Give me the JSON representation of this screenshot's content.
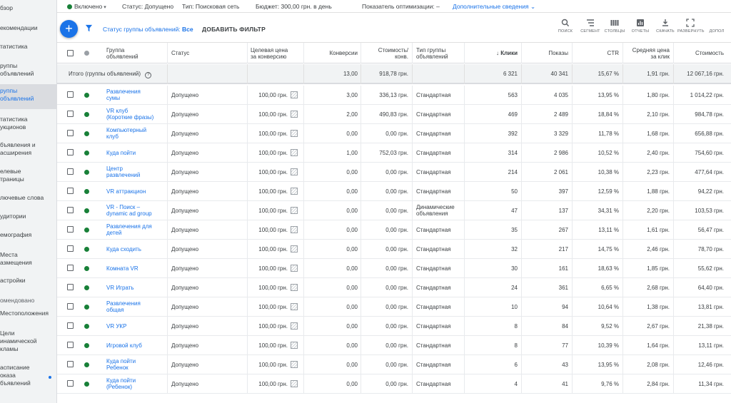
{
  "sidebar": {
    "items": [
      {
        "label": "бзор"
      },
      {
        "label": "екомендации"
      },
      {
        "label": "татистика"
      },
      {
        "label": "руппы\nобъявлений"
      },
      {
        "label": "руппы\nобъявлений",
        "active": true
      },
      {
        "label": "татистика\nукционов"
      },
      {
        "label": "бъявления и\nасширения"
      },
      {
        "label": "елевые\nтраницы"
      },
      {
        "label": "лючевые слова"
      },
      {
        "label": "удитории"
      },
      {
        "label": "емография"
      },
      {
        "label": "Места\nазмещения"
      },
      {
        "label": "астройки"
      },
      {
        "label": "омендовано",
        "section": true
      },
      {
        "label": "Местоположения"
      },
      {
        "label": "Цели\nинамической\nкламы"
      },
      {
        "label": "асписание\nоказа\nбъявлений",
        "dot": true
      }
    ]
  },
  "topbar": {
    "status": "Включено",
    "status_label": "Статус: Допущено",
    "type_label": "Тип: Поисковая сеть",
    "budget_label": "Бюджет: 300,00 грн. в день",
    "optimization_label": "Показатель оптимизации: –",
    "details_link": "Дополнительные сведения"
  },
  "toolbar": {
    "filter_prefix": "Статус группы объявлений: ",
    "filter_value": "Все",
    "add_filter": "ДОБАВИТЬ ФИЛЬТР",
    "tools": [
      {
        "label": "ПОИСК",
        "icon": "search-icon"
      },
      {
        "label": "СЕГМЕНТ",
        "icon": "segment-icon"
      },
      {
        "label": "СТОЛБЦЫ",
        "icon": "columns-icon"
      },
      {
        "label": "ОТЧЕТЫ",
        "icon": "reports-icon"
      },
      {
        "label": "СКАЧАТЬ",
        "icon": "download-icon"
      },
      {
        "label": "РАЗВЕРНУТЬ",
        "icon": "expand-icon"
      },
      {
        "label": "ДОПОЛ",
        "icon": "more-icon"
      }
    ]
  },
  "table": {
    "headers": {
      "group": "Группа\nобъявлений",
      "status": "Статус",
      "target": "Целевая цена\nза конверсию",
      "conversions": "Конверсии",
      "cost_conv": "Стоимость/\nконв.",
      "type": "Тип группы\nобъявлений",
      "clicks": "Клики",
      "impressions": "Показы",
      "ctr": "CTR",
      "avg_cpc": "Средняя цена\nза клик",
      "cost": "Стоимость"
    },
    "totals": {
      "label": "Итого (группы объявлений)",
      "conversions": "13,00",
      "cost_conv": "918,78 грн.",
      "clicks": "6 321",
      "impressions": "40 341",
      "ctr": "15,67 %",
      "avg_cpc": "1,91 грн.",
      "cost": "12 067,16 грн."
    },
    "rows": [
      {
        "name": "Развлечения\nсумы",
        "status": "Допущено",
        "target": "100,00 грн.",
        "conversions": "3,00",
        "cost_conv": "336,13 грн.",
        "type": "Стандартная",
        "clicks": "563",
        "impressions": "4 035",
        "ctr": "13,95 %",
        "avg_cpc": "1,80 грн.",
        "cost": "1 014,22 грн."
      },
      {
        "name": "VR клуб\n(Короткие фразы)",
        "status": "Допущено",
        "target": "100,00 грн.",
        "conversions": "2,00",
        "cost_conv": "490,83 грн.",
        "type": "Стандартная",
        "clicks": "469",
        "impressions": "2 489",
        "ctr": "18,84 %",
        "avg_cpc": "2,10 грн.",
        "cost": "984,78 грн."
      },
      {
        "name": "Компьютерный\nклуб",
        "status": "Допущено",
        "target": "100,00 грн.",
        "conversions": "0,00",
        "cost_conv": "0,00 грн.",
        "type": "Стандартная",
        "clicks": "392",
        "impressions": "3 329",
        "ctr": "11,78 %",
        "avg_cpc": "1,68 грн.",
        "cost": "656,88 грн."
      },
      {
        "name": "Куда пойти",
        "status": "Допущено",
        "target": "100,00 грн.",
        "conversions": "1,00",
        "cost_conv": "752,03 грн.",
        "type": "Стандартная",
        "clicks": "314",
        "impressions": "2 986",
        "ctr": "10,52 %",
        "avg_cpc": "2,40 грн.",
        "cost": "754,60 грн."
      },
      {
        "name": "Центр\nразвлечений",
        "status": "Допущено",
        "target": "100,00 грн.",
        "conversions": "0,00",
        "cost_conv": "0,00 грн.",
        "type": "Стандартная",
        "clicks": "214",
        "impressions": "2 061",
        "ctr": "10,38 %",
        "avg_cpc": "2,23 грн.",
        "cost": "477,64 грн."
      },
      {
        "name": "VR аттракцион",
        "status": "Допущено",
        "target": "100,00 грн.",
        "conversions": "0,00",
        "cost_conv": "0,00 грн.",
        "type": "Стандартная",
        "clicks": "50",
        "impressions": "397",
        "ctr": "12,59 %",
        "avg_cpc": "1,88 грн.",
        "cost": "94,22 грн."
      },
      {
        "name": "VR - Поиск –\ndynamic ad group",
        "status": "Допущено",
        "target": "100,00 грн.",
        "conversions": "0,00",
        "cost_conv": "0,00 грн.",
        "type": "Динамические\nобъявления",
        "clicks": "47",
        "impressions": "137",
        "ctr": "34,31 %",
        "avg_cpc": "2,20 грн.",
        "cost": "103,53 грн."
      },
      {
        "name": "Развлечения для\nдетей",
        "status": "Допущено",
        "target": "100,00 грн.",
        "conversions": "0,00",
        "cost_conv": "0,00 грн.",
        "type": "Стандартная",
        "clicks": "35",
        "impressions": "267",
        "ctr": "13,11 %",
        "avg_cpc": "1,61 грн.",
        "cost": "56,47 грн."
      },
      {
        "name": "Куда сходить",
        "status": "Допущено",
        "target": "100,00 грн.",
        "conversions": "0,00",
        "cost_conv": "0,00 грн.",
        "type": "Стандартная",
        "clicks": "32",
        "impressions": "217",
        "ctr": "14,75 %",
        "avg_cpc": "2,46 грн.",
        "cost": "78,70 грн."
      },
      {
        "name": "Комната VR",
        "status": "Допущено",
        "target": "100,00 грн.",
        "conversions": "0,00",
        "cost_conv": "0,00 грн.",
        "type": "Стандартная",
        "clicks": "30",
        "impressions": "161",
        "ctr": "18,63 %",
        "avg_cpc": "1,85 грн.",
        "cost": "55,62 грн."
      },
      {
        "name": "VR Играть",
        "status": "Допущено",
        "target": "100,00 грн.",
        "conversions": "0,00",
        "cost_conv": "0,00 грн.",
        "type": "Стандартная",
        "clicks": "24",
        "impressions": "361",
        "ctr": "6,65 %",
        "avg_cpc": "2,68 грн.",
        "cost": "64,40 грн."
      },
      {
        "name": "Развлечения\nобщая",
        "status": "Допущено",
        "target": "100,00 грн.",
        "conversions": "0,00",
        "cost_conv": "0,00 грн.",
        "type": "Стандартная",
        "clicks": "10",
        "impressions": "94",
        "ctr": "10,64 %",
        "avg_cpc": "1,38 грн.",
        "cost": "13,81 грн."
      },
      {
        "name": "VR УКР",
        "status": "Допущено",
        "target": "100,00 грн.",
        "conversions": "0,00",
        "cost_conv": "0,00 грн.",
        "type": "Стандартная",
        "clicks": "8",
        "impressions": "84",
        "ctr": "9,52 %",
        "avg_cpc": "2,67 грн.",
        "cost": "21,38 грн."
      },
      {
        "name": "Игровой клуб",
        "status": "Допущено",
        "target": "100,00 грн.",
        "conversions": "0,00",
        "cost_conv": "0,00 грн.",
        "type": "Стандартная",
        "clicks": "8",
        "impressions": "77",
        "ctr": "10,39 %",
        "avg_cpc": "1,64 грн.",
        "cost": "13,11 грн."
      },
      {
        "name": "Куда пойти\nРебенок",
        "status": "Допущено",
        "target": "100,00 грн.",
        "conversions": "0,00",
        "cost_conv": "0,00 грн.",
        "type": "Стандартная",
        "clicks": "6",
        "impressions": "43",
        "ctr": "13,95 %",
        "avg_cpc": "2,08 грн.",
        "cost": "12,46 грн."
      },
      {
        "name": "Куда пойти\n(Ребенок)",
        "status": "Допущено",
        "target": "100,00 грн.",
        "conversions": "0,00",
        "cost_conv": "0,00 грн.",
        "type": "Стандартная",
        "clicks": "4",
        "impressions": "41",
        "ctr": "9,76 %",
        "avg_cpc": "2,84 грн.",
        "cost": "11,34 грн."
      }
    ]
  },
  "colors": {
    "accent": "#1a73e8",
    "enabled": "#188038",
    "sidebar_bg": "#f1f3f4"
  }
}
